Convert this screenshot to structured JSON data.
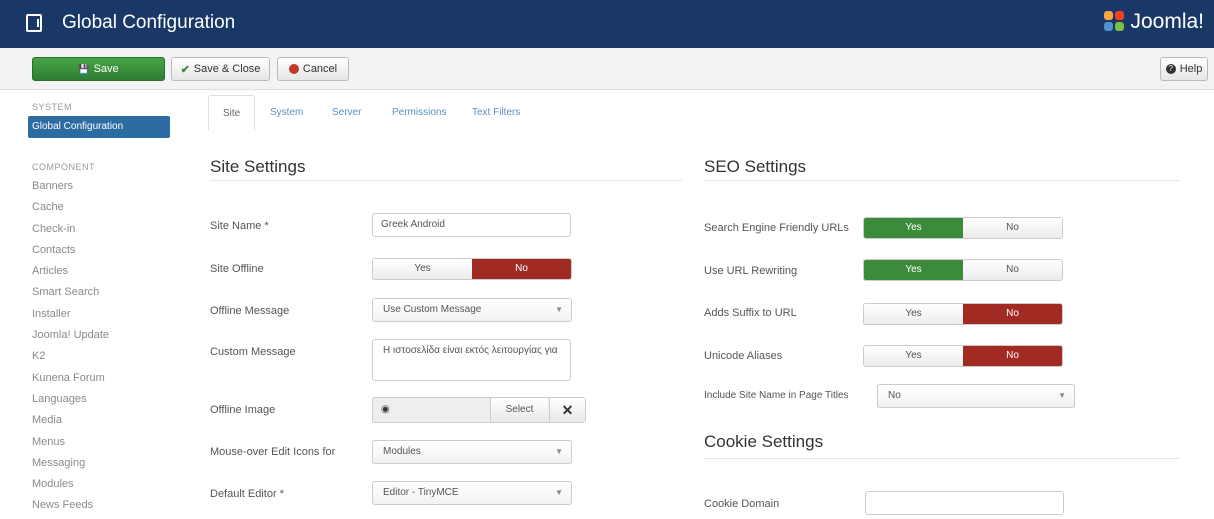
{
  "header": {
    "title": "Global Configuration",
    "logo_text": "Joomla!"
  },
  "toolbar": {
    "save_label": "Save",
    "save_close_label": "Save & Close",
    "cancel_label": "Cancel",
    "help_label": "Help"
  },
  "sidebar": {
    "system_heading": "SYSTEM",
    "active_item": "Global Configuration",
    "component_heading": "COMPONENT",
    "items": [
      {
        "label": "Banners"
      },
      {
        "label": "Cache"
      },
      {
        "label": "Check-in"
      },
      {
        "label": "Contacts"
      },
      {
        "label": "Articles"
      },
      {
        "label": "Smart Search"
      },
      {
        "label": "Installer"
      },
      {
        "label": "Joomla! Update"
      },
      {
        "label": "K2"
      },
      {
        "label": "Kunena Forum"
      },
      {
        "label": "Languages"
      },
      {
        "label": "Media"
      },
      {
        "label": "Menus"
      },
      {
        "label": "Messaging"
      },
      {
        "label": "Modules"
      },
      {
        "label": "News Feeds"
      }
    ]
  },
  "tabs": [
    {
      "label": "Site"
    },
    {
      "label": "System"
    },
    {
      "label": "Server"
    },
    {
      "label": "Permissions"
    },
    {
      "label": "Text Filters"
    }
  ],
  "site_settings": {
    "title": "Site Settings",
    "site_name_label": "Site Name *",
    "site_name_value": "Greek Android",
    "site_offline_label": "Site Offline",
    "site_offline_yes": "Yes",
    "site_offline_no": "No",
    "offline_message_label": "Offline Message",
    "offline_message_value": "Use Custom Message",
    "custom_message_label": "Custom Message",
    "custom_message_value": "Η ιστοσελίδα είναι εκτός λειτουργίας για",
    "offline_image_label": "Offline Image",
    "offline_image_select": "Select",
    "mouseover_label": "Mouse-over Edit Icons for",
    "mouseover_value": "Modules",
    "default_editor_label": "Default Editor *",
    "default_editor_value": "Editor - TinyMCE"
  },
  "seo_settings": {
    "title": "SEO Settings",
    "sef_label": "Search Engine Friendly URLs",
    "sef_yes": "Yes",
    "sef_no": "No",
    "rewrite_label": "Use URL Rewriting",
    "rewrite_yes": "Yes",
    "rewrite_no": "No",
    "suffix_label": "Adds Suffix to URL",
    "suffix_yes": "Yes",
    "suffix_no": "No",
    "unicode_label": "Unicode Aliases",
    "unicode_yes": "Yes",
    "unicode_no": "No",
    "site_name_titles_label": "Include Site Name in Page Titles",
    "site_name_titles_value": "No"
  },
  "cookie_settings": {
    "title": "Cookie Settings",
    "domain_label": "Cookie Domain",
    "domain_value": ""
  },
  "colors": {
    "header_bg": "#1a3867",
    "save_green": "#3c8a3c",
    "no_red": "#a12b23",
    "active_blue": "#2d6ca2"
  }
}
